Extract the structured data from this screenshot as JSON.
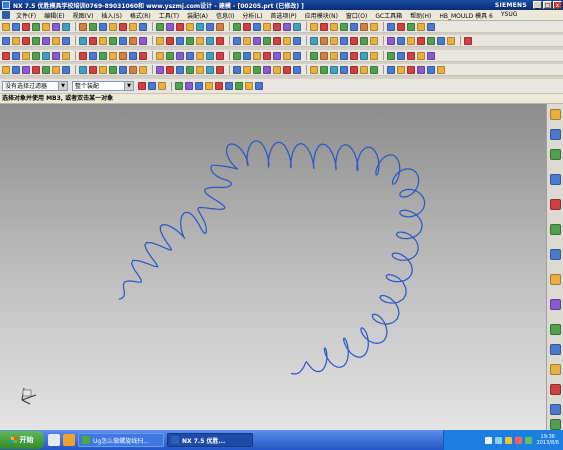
{
  "window": {
    "title": "NX 7.5 优胜模具学校培训0769-89031060和 www.yszmj.com设计 - 建模 - [00205.prt (已修改)  ]",
    "brand": "SIEMENS",
    "buttons": [
      "_",
      "□",
      "x"
    ]
  },
  "menu": [
    "文件(F)",
    "编辑(E)",
    "视图(V)",
    "插入(S)",
    "格式(R)",
    "工具(T)",
    "装配(A)",
    "信息(I)",
    "分析(L)",
    "首选项(P)",
    "应用模块(N)",
    "窗口(O)",
    "GC工具箱",
    "帮助(H)",
    "HB_MOULD 模具 6",
    "YSUG"
  ],
  "toolbars": {
    "row_icon_colors": [
      [
        "#e8b040",
        "#4a7ad0",
        "#d04040",
        "#50a050",
        "#e8b040",
        "#8a5ad0",
        "#40a0c0",
        "#d08040",
        "#50a050",
        "#4a7ad0",
        "#e8b040",
        "#d04040",
        "#e8b040",
        "#4a7ad0",
        "#50a050",
        "#8a5ad0",
        "#d04040",
        "#e8b040",
        "#40a0c0",
        "#4a7ad0",
        "#d08040",
        "#50a050",
        "#d04040",
        "#4a7ad0",
        "#e8b040",
        "#d04040",
        "#8a5ad0",
        "#40a0c0",
        "#e8b040",
        "#d04040",
        "#e8b040",
        "#50a050",
        "#4a7ad0",
        "#d08040",
        "#e8b040",
        "#4a7ad0",
        "#d04040",
        "#50a050",
        "#e8b040",
        "#4a7ad0"
      ],
      [
        "#4a7ad0",
        "#e8b040",
        "#d04040",
        "#50a050",
        "#8a5ad0",
        "#e8b040",
        "#4a7ad0",
        "#40a0c0",
        "#d04040",
        "#e8b040",
        "#50a050",
        "#4a7ad0",
        "#d08040",
        "#8a5ad0",
        "#e8b040",
        "#d04040",
        "#4a7ad0",
        "#50a050",
        "#e8b040",
        "#40a0c0",
        "#d04040",
        "#4a7ad0",
        "#e8b040",
        "#8a5ad0",
        "#50a050",
        "#d04040",
        "#e8b040",
        "#4a7ad0",
        "#40a0c0",
        "#d08040",
        "#e8b040",
        "#4a7ad0",
        "#d04040",
        "#50a050",
        "#e8b040",
        "#8a5ad0",
        "#4a7ad0",
        "#e8b040",
        "#d04040",
        "#50a050",
        "#4a7ad0",
        "#e8b040",
        "#d04040"
      ],
      [
        "#d04040",
        "#4a7ad0",
        "#e8b040",
        "#50a050",
        "#40a0c0",
        "#8a5ad0",
        "#e8b040",
        "#d04040",
        "#4a7ad0",
        "#50a050",
        "#e8b040",
        "#d08040",
        "#4a7ad0",
        "#d04040",
        "#e8b040",
        "#50a050",
        "#8a5ad0",
        "#4a7ad0",
        "#e8b040",
        "#40a0c0",
        "#d04040",
        "#50a050",
        "#4a7ad0",
        "#e8b040",
        "#d04040",
        "#8a5ad0",
        "#e8b040",
        "#4a7ad0",
        "#50a050",
        "#d08040",
        "#e8b040",
        "#4a7ad0",
        "#d04040",
        "#40a0c0",
        "#e8b040",
        "#50a050",
        "#4a7ad0",
        "#d04040",
        "#e8b040",
        "#8a5ad0"
      ],
      [
        "#e8b040",
        "#4a7ad0",
        "#8a5ad0",
        "#d04040",
        "#50a050",
        "#e8b040",
        "#4a7ad0",
        "#40a0c0",
        "#d04040",
        "#e8b040",
        "#50a050",
        "#4a7ad0",
        "#d08040",
        "#e8b040",
        "#8a5ad0",
        "#d04040",
        "#4a7ad0",
        "#50a050",
        "#e8b040",
        "#40a0c0",
        "#d04040",
        "#4a7ad0",
        "#e8b040",
        "#50a050",
        "#8a5ad0",
        "#e8b040",
        "#d04040",
        "#4a7ad0",
        "#e8b040",
        "#50a050",
        "#40a0c0",
        "#4a7ad0",
        "#d04040",
        "#e8b040",
        "#50a050",
        "#4a7ad0",
        "#e8b040",
        "#d04040",
        "#8a5ad0",
        "#4a7ad0",
        "#e8b040"
      ]
    ]
  },
  "filter": {
    "type_filter": "没有选择过滤器",
    "scope": "整个装配"
  },
  "cue_line": "选择对象并使用 MB3, 或者双击某一对象",
  "resource_bar": {
    "icon_colors": [
      "#e8b040",
      "#4a7ad0",
      "#50a050",
      "#4a7ad0",
      "#d04040",
      "#50a050",
      "#4a7ad0",
      "#e8b040",
      "#8a5ad0",
      "#50a050",
      "#4a7ad0",
      "#e8b040",
      "#d04040",
      "#4a7ad0",
      "#50a050"
    ]
  },
  "taskbar": {
    "start_label": "开始",
    "tasks": [
      {
        "label": "Ug怎么做螺旋线扫...",
        "active": false,
        "icon_color": "#4caa3c"
      },
      {
        "label": "NX 7.5 优胜...",
        "active": true,
        "icon_color": "#2c5fb8"
      }
    ],
    "clock_time": "19:36",
    "clock_date": "2013/8/6"
  },
  "colors": {
    "curve": "#2a55c6",
    "axis_triad": "#333333"
  }
}
